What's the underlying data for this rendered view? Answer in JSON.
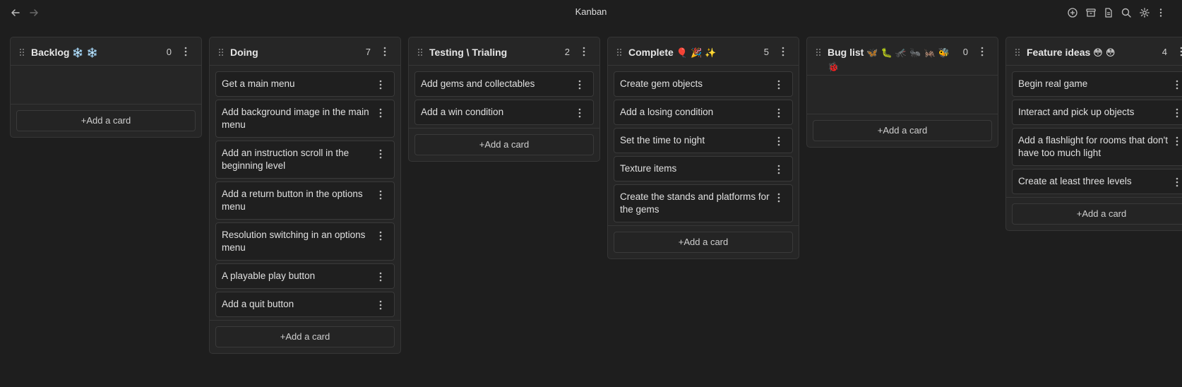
{
  "window": {
    "title": "Kanban"
  },
  "nav": {
    "back_icon": "arrow-left-icon",
    "forward_icon": "arrow-right-icon"
  },
  "toolbar": {
    "icons": [
      "plus-circle-icon",
      "archive-icon",
      "document-icon",
      "search-icon",
      "gear-icon",
      "more-vertical-icon"
    ]
  },
  "add_card_label": "+Add a card",
  "lanes": [
    {
      "title": "Backlog",
      "emoji": "❄️ ❄️",
      "count": "0",
      "cards": []
    },
    {
      "title": "Doing",
      "emoji": "",
      "count": "7",
      "cards": [
        "Get a main menu",
        "Add background image in the main menu",
        "Add an instruction scroll in the beginning level",
        "Add a return button in the options menu",
        "Resolution switching in an options menu",
        "A playable play button",
        "Add a quit button"
      ]
    },
    {
      "title": "Testing \\ Trialing",
      "emoji": "",
      "count": "2",
      "cards": [
        "Add gems and collectables",
        "Add a win condition"
      ]
    },
    {
      "title": "Complete",
      "emoji": "🎈 🎉 ✨",
      "count": "5",
      "cards": [
        "Create gem objects",
        "Add a losing condition",
        "Set the time to night",
        "Texture items",
        "Create the stands and platforms for the gems"
      ]
    },
    {
      "title": "Bug list",
      "emoji": "🦋 🐛 🦟 🐜 🦗 🐝 🐞",
      "count": "0",
      "cards": []
    },
    {
      "title": "Feature ideas",
      "emoji": "😳 😳",
      "count": "4",
      "cards": [
        "Begin real game",
        "Interact and pick up objects",
        "Add a flashlight for rooms that don't have too much light",
        "Create at least three levels"
      ]
    }
  ]
}
